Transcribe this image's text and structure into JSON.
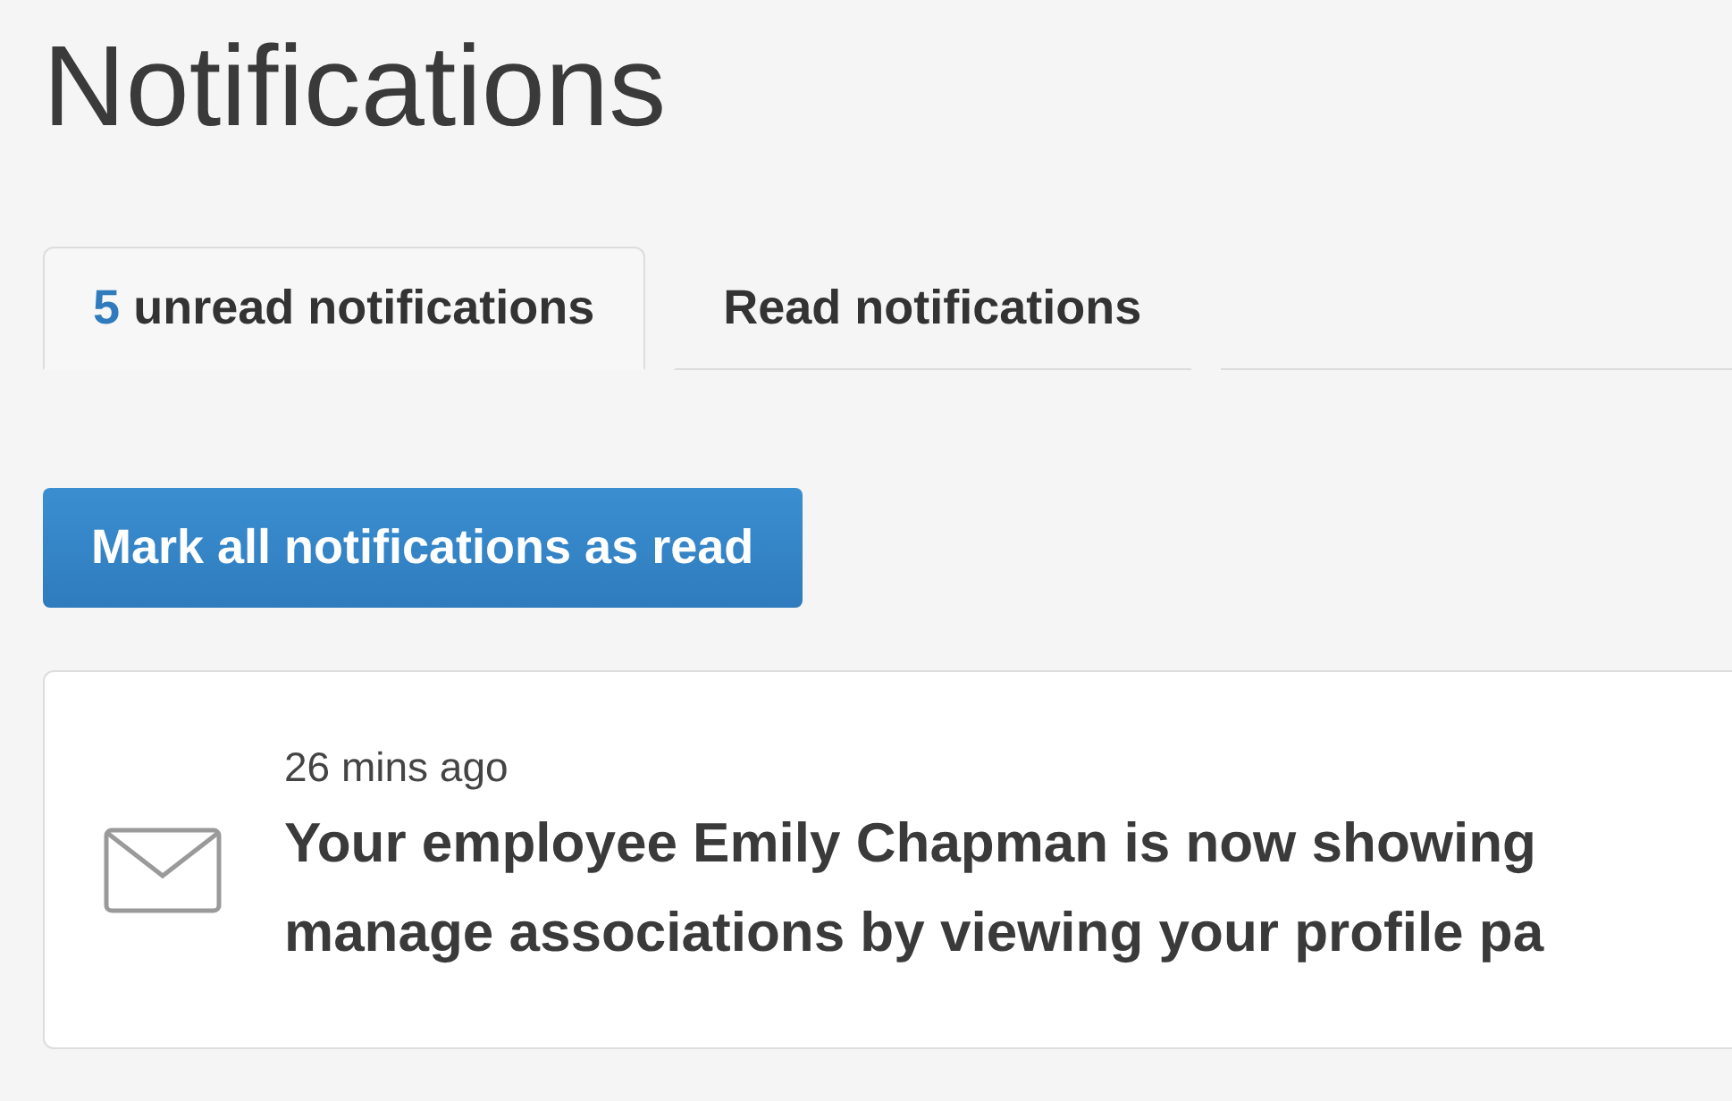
{
  "page": {
    "title": "Notifications"
  },
  "tabs": [
    {
      "count": "5",
      "label": "unread notifications",
      "selected": true
    },
    {
      "label": "Read notifications",
      "selected": false
    }
  ],
  "mark_all_button": "Mark all notifications as read",
  "notifications": [
    {
      "time": "26 mins ago",
      "lines": [
        "Your employee Emily Chapman is now showing",
        "manage associations by viewing your profile pa"
      ]
    }
  ]
}
